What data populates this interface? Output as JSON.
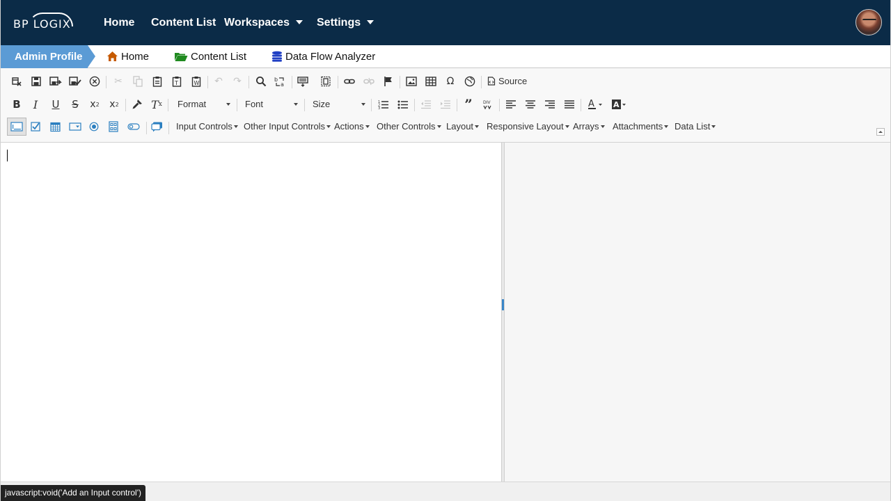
{
  "topnav": {
    "logo": "BP LOGIX",
    "items": [
      {
        "label": "Home",
        "dropdown": false
      },
      {
        "label": "Content List",
        "dropdown": false
      },
      {
        "label": "Workspaces",
        "dropdown": true
      },
      {
        "label": "Settings",
        "dropdown": true
      }
    ],
    "avatar_icon": "user-avatar"
  },
  "breadcrumb": {
    "active": "Admin Profile",
    "items": [
      {
        "label": "Home",
        "icon": "home-icon",
        "color": "#c65a00"
      },
      {
        "label": "Content List",
        "icon": "folder-open-icon",
        "color": "#1f8a1f"
      },
      {
        "label": "Data Flow Analyzer",
        "icon": "database-icon",
        "color": "#1f3fc4"
      }
    ]
  },
  "toolbar": {
    "row1": {
      "source_label": "Source"
    },
    "row2": {
      "format_combo": "Format",
      "font_combo": "Font",
      "size_combo": "Size"
    },
    "row3": {
      "menus": [
        "Input Controls",
        "Other Input Controls",
        "Actions",
        "Other Controls",
        "Layout",
        "Responsive Layout",
        "Arrays",
        "Attachments",
        "Data List"
      ]
    }
  },
  "status": {
    "text": "javascript:void('Add an Input control')"
  },
  "colors": {
    "nav_bg": "#0b2b47",
    "crumb_active_bg": "#5b9bd5",
    "toolbar_bg": "#f8f8f8",
    "control_icon_blue": "#2b7fc0"
  }
}
